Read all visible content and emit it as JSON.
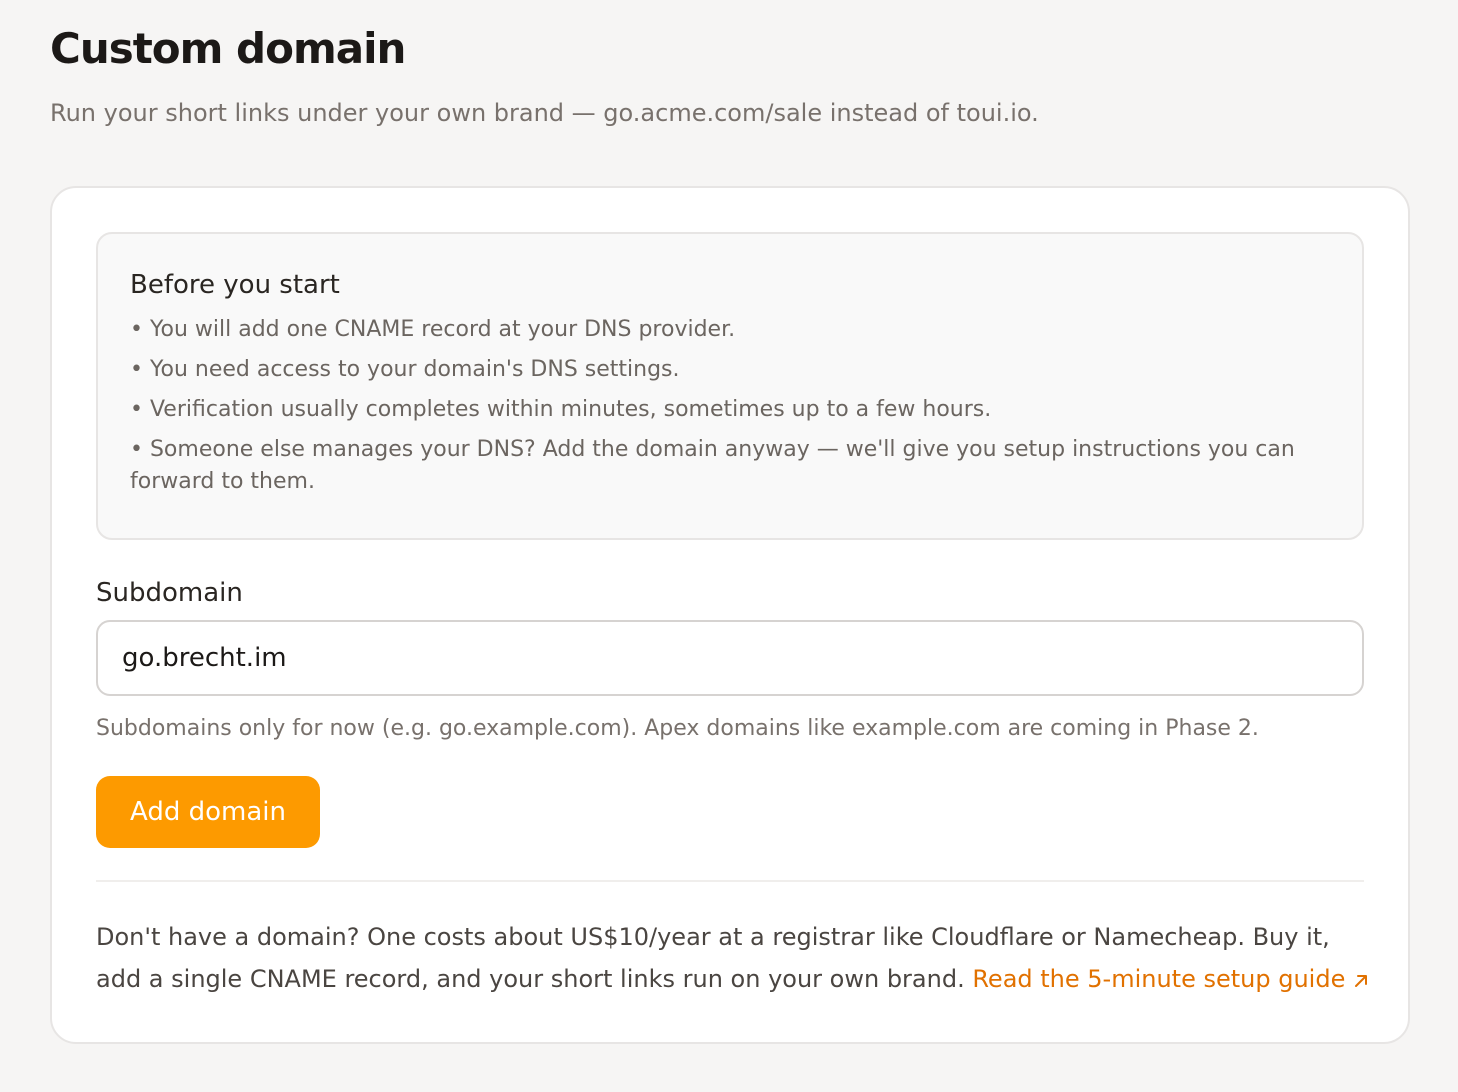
{
  "header": {
    "title": "Custom domain",
    "subtitle": "Run your short links under your own brand — go.acme.com/sale instead of toui.io."
  },
  "info": {
    "title": "Before you start",
    "items": [
      "• You will add one CNAME record at your DNS provider.",
      "• You need access to your domain's DNS settings.",
      "• Verification usually completes within minutes, sometimes up to a few hours.",
      "• Someone else manages your DNS? Add the domain anyway — we'll give you setup instructions you can forward to them."
    ]
  },
  "form": {
    "label": "Subdomain",
    "value": "go.brecht.im",
    "hint": "Subdomains only for now (e.g. go.example.com). Apex domains like example.com are coming in Phase 2.",
    "submit_label": "Add domain"
  },
  "footer": {
    "text": "Don't have a domain? One costs about US$10/year at a registrar like Cloudflare or Namecheap. Buy it, add a single CNAME record, and your short links run on your own brand. ",
    "link_label": "Read the 5-minute setup guide",
    "link_icon": "arrow-up-right-icon"
  },
  "colors": {
    "accent": "#fd9a00",
    "link": "#e17100",
    "background": "#f6f5f4"
  }
}
